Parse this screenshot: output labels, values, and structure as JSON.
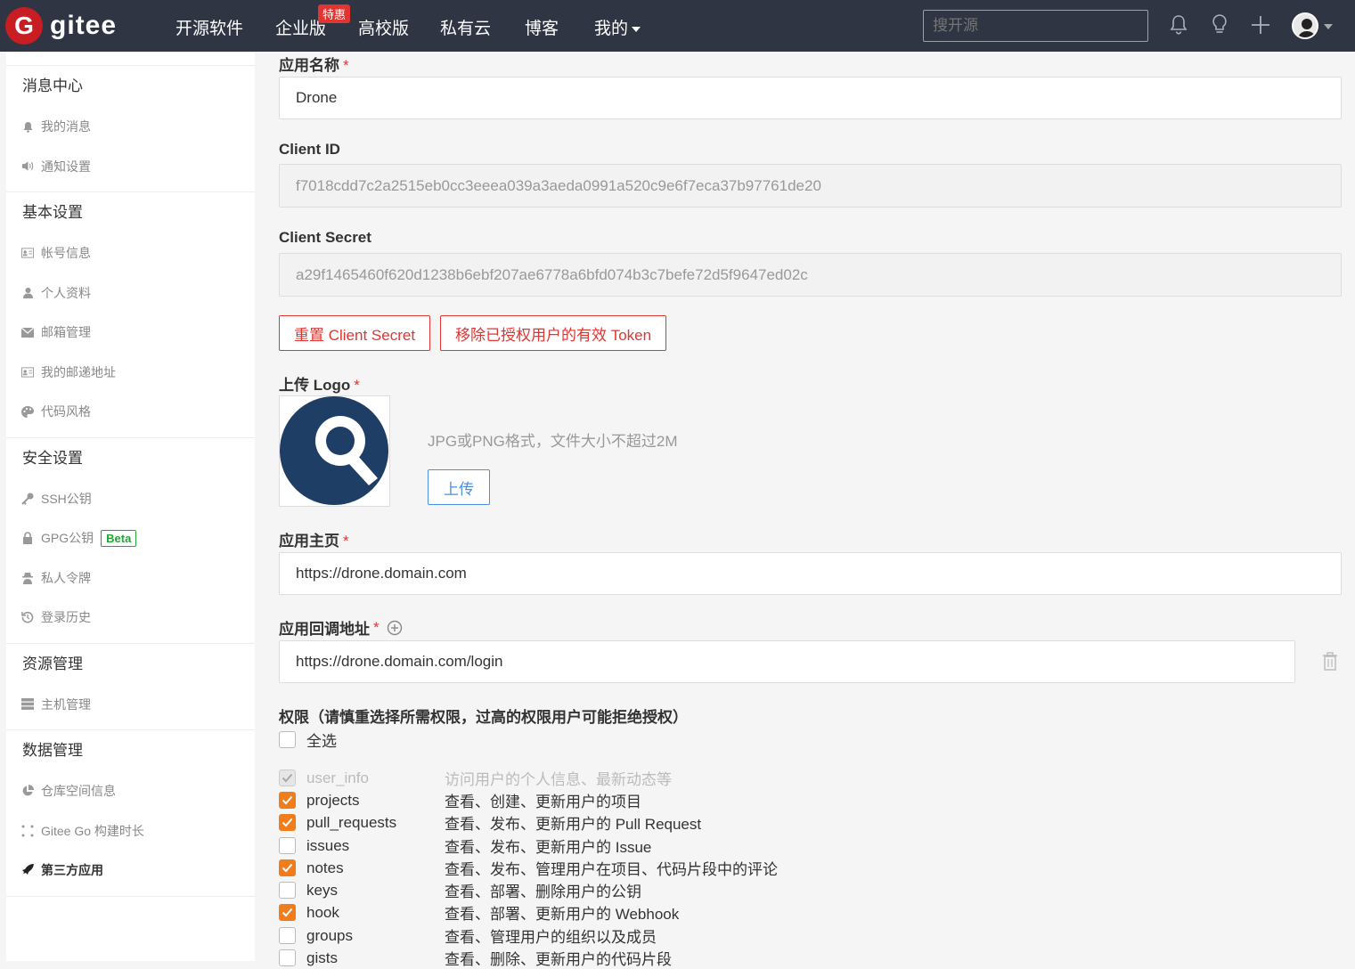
{
  "nav": {
    "logo_text": "gitee",
    "items": [
      "开源软件",
      "企业版",
      "高校版",
      "私有云",
      "博客",
      "我的"
    ],
    "hot_badge": "特惠",
    "search_placeholder": "搜开源"
  },
  "sidebar": {
    "sections": [
      {
        "title": "消息中心",
        "items": [
          {
            "icon": "bell-icon",
            "label": "我的消息"
          },
          {
            "icon": "volume-icon",
            "label": "通知设置"
          }
        ]
      },
      {
        "title": "基本设置",
        "items": [
          {
            "icon": "id-card-icon",
            "label": "帐号信息"
          },
          {
            "icon": "user-icon",
            "label": "个人资料"
          },
          {
            "icon": "mail-icon",
            "label": "邮箱管理"
          },
          {
            "icon": "id-card-icon",
            "label": "我的邮递地址"
          },
          {
            "icon": "palette-icon",
            "label": "代码风格"
          }
        ]
      },
      {
        "title": "安全设置",
        "items": [
          {
            "icon": "key-icon",
            "label": "SSH公钥"
          },
          {
            "icon": "lock-icon",
            "label": "GPG公钥",
            "badge": "Beta"
          },
          {
            "icon": "spy-icon",
            "label": "私人令牌"
          },
          {
            "icon": "history-icon",
            "label": "登录历史"
          }
        ]
      },
      {
        "title": "资源管理",
        "items": [
          {
            "icon": "server-icon",
            "label": "主机管理"
          }
        ]
      },
      {
        "title": "数据管理",
        "items": [
          {
            "icon": "pie-chart-icon",
            "label": "仓库空间信息"
          },
          {
            "icon": "build-icon",
            "label": "Gitee Go 构建时长"
          },
          {
            "icon": "rocket-icon",
            "label": "第三方应用",
            "active": true
          }
        ]
      }
    ]
  },
  "form": {
    "app_name_label": "应用名称",
    "app_name_value": "Drone",
    "client_id_label": "Client ID",
    "client_id_value": "f7018cdd7c2a2515eb0cc3eeea039a3aeda0991a520c9e6f7eca37b97761de20",
    "client_secret_label": "Client Secret",
    "client_secret_value": "a29f1465460f620d1238b6ebf207ae6778a6bfd074b3c7befe72d5f9647ed02c",
    "reset_secret_button": "重置 Client Secret",
    "revoke_tokens_button": "移除已授权用户的有效 Token",
    "upload_logo_label": "上传 Logo",
    "upload_hint": "JPG或PNG格式，文件大小不超过2M",
    "upload_button": "上传",
    "homepage_label": "应用主页",
    "homepage_value": "https://drone.domain.com",
    "callback_label": "应用回调地址",
    "callback_value": "https://drone.domain.com/login",
    "permissions_label": "权限（请慎重选择所需权限，过高的权限用户可能拒绝授权）",
    "select_all_label": "全选",
    "required_mark": "*"
  },
  "permissions": [
    {
      "name": "user_info",
      "desc": "访问用户的个人信息、最新动态等",
      "checked": true,
      "disabled": true
    },
    {
      "name": "projects",
      "desc": "查看、创建、更新用户的项目",
      "checked": true
    },
    {
      "name": "pull_requests",
      "desc": "查看、发布、更新用户的 Pull Request",
      "checked": true
    },
    {
      "name": "issues",
      "desc": "查看、发布、更新用户的 Issue",
      "checked": false
    },
    {
      "name": "notes",
      "desc": "查看、发布、管理用户在项目、代码片段中的评论",
      "checked": true
    },
    {
      "name": "keys",
      "desc": "查看、部署、删除用户的公钥",
      "checked": false
    },
    {
      "name": "hook",
      "desc": "查看、部署、更新用户的 Webhook",
      "checked": true
    },
    {
      "name": "groups",
      "desc": "查看、管理用户的组织以及成员",
      "checked": false
    },
    {
      "name": "gists",
      "desc": "查看、删除、更新用户的代码片段",
      "checked": false
    }
  ],
  "colors": {
    "navbar": "#2f3542",
    "brand": "#c71d23",
    "danger": "#e23431",
    "checkbox_on": "#f07c1b",
    "primary": "#4a90e2"
  }
}
